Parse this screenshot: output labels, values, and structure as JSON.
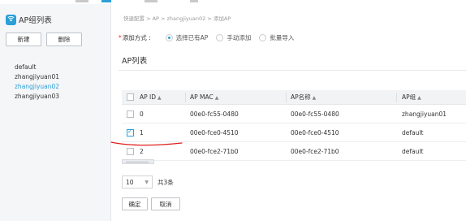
{
  "sidebar": {
    "title": "AP组列表",
    "buttons": {
      "new": "新建",
      "delete": "删除"
    },
    "items": [
      {
        "label": "default"
      },
      {
        "label": "zhangjiyuan01"
      },
      {
        "label": "zhangjiyuan02"
      },
      {
        "label": "zhangjiyuan03"
      }
    ],
    "active_item": "zhangjiyuan02",
    "accent_color": "#2a9fd8"
  },
  "breadcrumb": "快速配置 > AP > zhangjiyuan02 > 添加AP",
  "add_method": {
    "required_mark": "*",
    "label": "添加方式 :",
    "options": [
      {
        "label": "选择已有AP",
        "selected": true
      },
      {
        "label": "手动添加",
        "selected": false
      },
      {
        "label": "批量导入",
        "selected": false
      }
    ]
  },
  "section_title": "AP列表",
  "table": {
    "sort_glyph": "▲",
    "columns": [
      "AP ID",
      "AP MAC",
      "AP名称",
      "AP组"
    ],
    "rows": [
      {
        "id": "0",
        "mac": "00e0-fc55-0480",
        "name": "00e0-fc55-0480",
        "group": "zhangjiyuan01",
        "checked": false
      },
      {
        "id": "1",
        "mac": "00e0-fce0-4510",
        "name": "00e0-fce0-4510",
        "group": "default",
        "checked": true
      },
      {
        "id": "2",
        "mac": "00e0-fce2-71b0",
        "name": "00e0-fce2-71b0",
        "group": "default",
        "checked": false
      }
    ]
  },
  "pager": {
    "page_size": "10",
    "total": "共3条"
  },
  "actions": {
    "ok": "确定",
    "cancel": "取消"
  },
  "annotation_color": "#e02020"
}
